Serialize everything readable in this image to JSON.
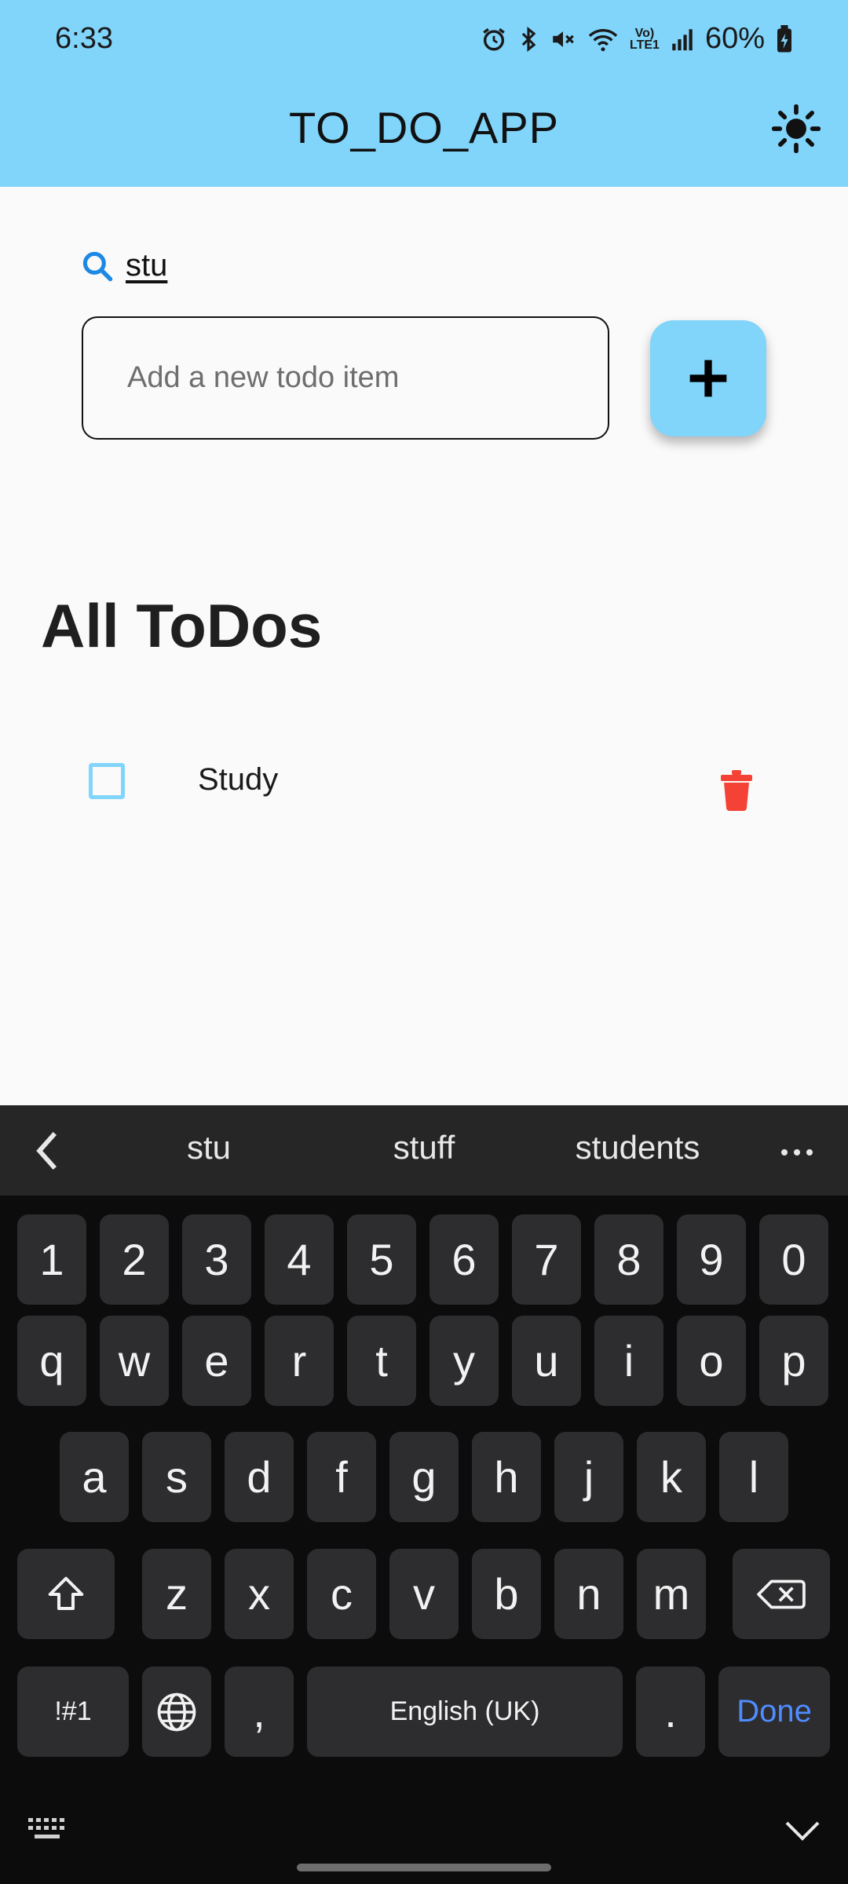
{
  "status_bar": {
    "time": "6:33",
    "lte_top": "Vo)",
    "lte_bottom": "LTE1",
    "battery": "60%"
  },
  "app": {
    "title": "TO_DO_APP",
    "theme_icon": "sun-icon",
    "accent_color": "#81d4fa"
  },
  "search": {
    "icon": "search-icon",
    "value": "stu"
  },
  "new_todo": {
    "placeholder": "Add a new todo item",
    "add_icon": "plus-icon"
  },
  "list": {
    "heading": "All ToDos",
    "items": [
      {
        "text": "Study",
        "checked": false,
        "delete_icon": "trash-icon",
        "delete_color": "#f44336"
      }
    ]
  },
  "keyboard": {
    "suggestions": [
      "stu",
      "stuff",
      "students"
    ],
    "rows": [
      [
        "1",
        "2",
        "3",
        "4",
        "5",
        "6",
        "7",
        "8",
        "9",
        "0"
      ],
      [
        "q",
        "w",
        "e",
        "r",
        "t",
        "y",
        "u",
        "i",
        "o",
        "p"
      ],
      [
        "a",
        "s",
        "d",
        "f",
        "g",
        "h",
        "j",
        "k",
        "l"
      ],
      [
        "z",
        "x",
        "c",
        "v",
        "b",
        "n",
        "m"
      ]
    ],
    "symbols_label": "!#1",
    "comma": ",",
    "space_label": "English (UK)",
    "period": ".",
    "done_label": "Done"
  }
}
